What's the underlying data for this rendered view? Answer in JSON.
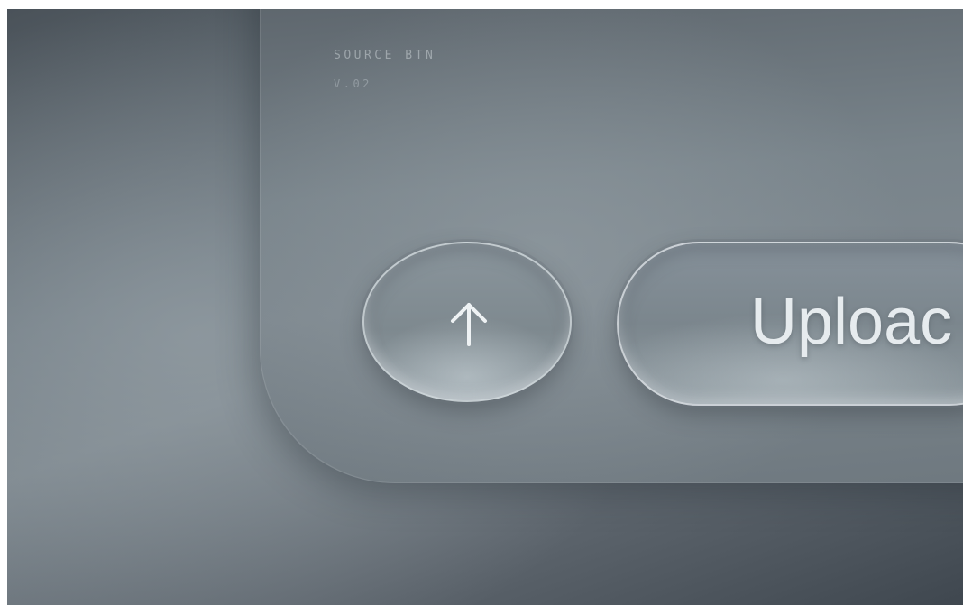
{
  "panel": {
    "label": "SOURCE BTN",
    "version": "V.02"
  },
  "icon_button": {
    "icon": "arrow-up-icon"
  },
  "upload_button": {
    "label": "Uploac"
  },
  "colors": {
    "background": "#6f7a82",
    "panel": "#78838a",
    "button_border": "#e0e6ea",
    "text": "#e6ebee"
  }
}
